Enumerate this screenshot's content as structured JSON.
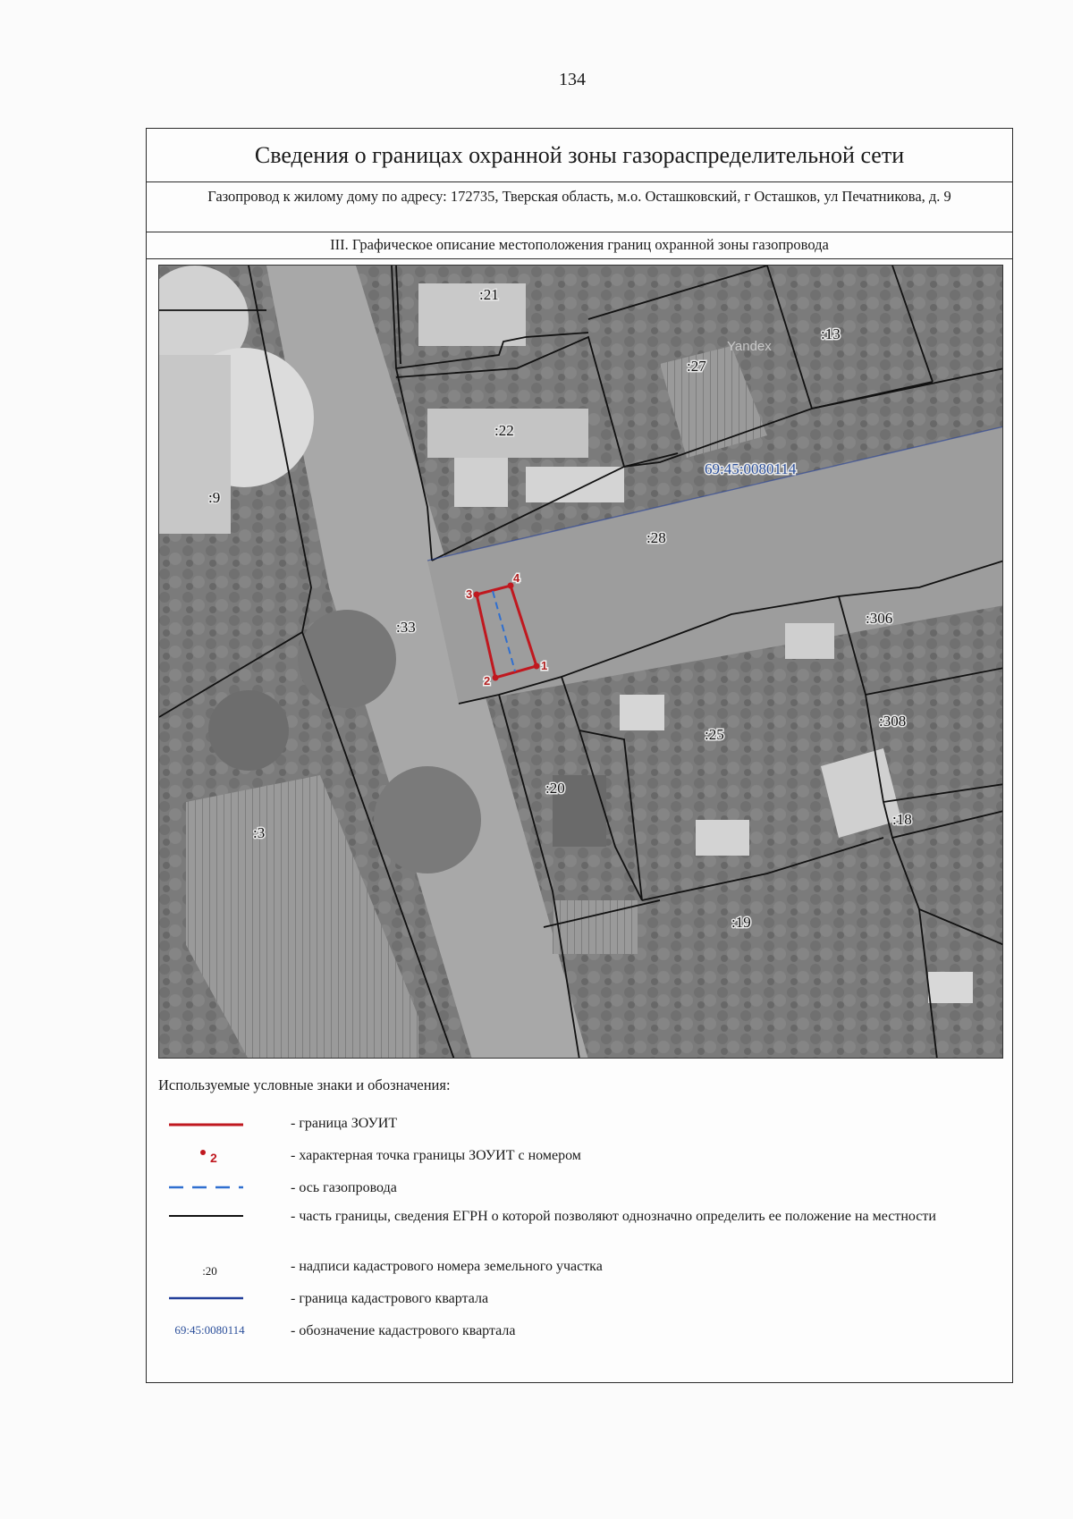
{
  "page_number": "134",
  "title": "Сведения о границах охранной зоны газораспределительной сети",
  "subtitle": "Газопровод к жилому дому по адресу: 172735, Тверская область, м.о. Осташковский, г Осташков, ул Печатникова, д. 9",
  "section_title": "III. Графическое описание местоположения границ охранной зоны газопровода",
  "map": {
    "parcel_labels": [
      ":21",
      ":13",
      ":27",
      ":22",
      ":9",
      ":28",
      ":33",
      ":306",
      ":25",
      ":308",
      ":20",
      ":3",
      ":18",
      ":19"
    ],
    "quarter_label": "69:45:0080114",
    "watermark": "Yandex",
    "zone_points": [
      "1",
      "2",
      "3",
      "4"
    ]
  },
  "legend": {
    "title": "Используемые условные знаки и обозначения:",
    "items": [
      {
        "symbol": "red-line",
        "text": "- граница ЗОУИТ"
      },
      {
        "symbol": "red-point",
        "symbol_text": "2",
        "text": "- характерная точка границы ЗОУИТ с номером"
      },
      {
        "symbol": "blue-dashed-line",
        "text": "- ось газопровода"
      },
      {
        "symbol": "black-line",
        "text": "- часть границы, сведения ЕГРН о которой позволяют однозначно определить ее положение на местности"
      },
      {
        "symbol": "label",
        "symbol_text": ":20",
        "text": "- надписи кадастрового номера земельного участка"
      },
      {
        "symbol": "blue-line",
        "text": "- граница кадастрового квартала"
      },
      {
        "symbol": "quarter-label",
        "symbol_text": "69:45:0080114",
        "text": "- обозначение кадастрового квартала"
      }
    ]
  },
  "colors": {
    "zone_boundary": "#c0181f",
    "gas_axis": "#2f6fd0",
    "parcel_boundary": "#111111",
    "quarter_boundary": "#233f9a",
    "quarter_label": "#2b4f9a"
  }
}
